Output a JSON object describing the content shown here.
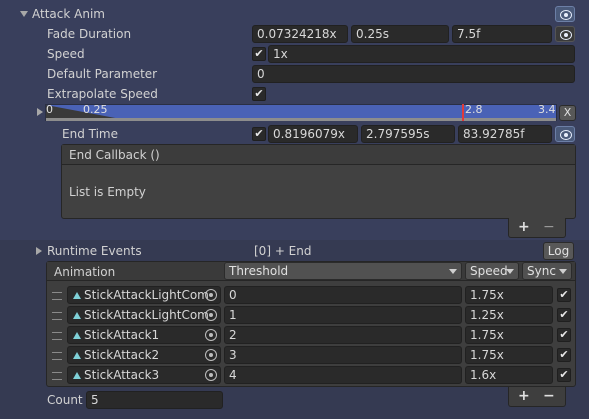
{
  "header": {
    "title": "Attack Anim"
  },
  "fade_duration": {
    "label": "Fade Duration",
    "values": [
      "0.07324218x",
      "0.25s",
      "7.5f"
    ]
  },
  "speed": {
    "label": "Speed",
    "checked": true,
    "value": "1x"
  },
  "default_parameter": {
    "label": "Default Parameter",
    "value": "0"
  },
  "extrapolate_speed": {
    "label": "Extrapolate Speed",
    "checked": true
  },
  "timeline": {
    "start_label": "0",
    "tick_label": "0.25",
    "end_time_label": "2.8",
    "length_label": "3.4",
    "close_label": "X"
  },
  "end_time": {
    "label": "End Time",
    "checked": true,
    "values": [
      "0.8196079x",
      "2.797595s",
      "83.92785f"
    ]
  },
  "end_callback": {
    "header": "End Callback ()",
    "empty_text": "List is Empty",
    "add_label": "+",
    "remove_label": "−"
  },
  "runtime_events": {
    "label": "Runtime Events",
    "summary": "[0] + End",
    "log_button": "Log"
  },
  "animation_table": {
    "column_animation": "Animation",
    "column_threshold": "Threshold",
    "column_speed": "Speed",
    "column_sync": "Sync",
    "rows": [
      {
        "clip": "StickAttackLightCom",
        "threshold": "0",
        "speed": "1.75x",
        "sync": true
      },
      {
        "clip": "StickAttackLightCom",
        "threshold": "1",
        "speed": "1.25x",
        "sync": true
      },
      {
        "clip": "StickAttack1",
        "threshold": "2",
        "speed": "1.75x",
        "sync": true
      },
      {
        "clip": "StickAttack2",
        "threshold": "3",
        "speed": "1.75x",
        "sync": true
      },
      {
        "clip": "StickAttack3",
        "threshold": "4",
        "speed": "1.6x",
        "sync": true
      }
    ],
    "count_label": "Count",
    "count_value": "5",
    "add_label": "+",
    "remove_label": "−"
  },
  "colors": {
    "panel_blue": "#393f5c",
    "timeline_fill": "#4a62b6",
    "end_marker": "#e03a3a",
    "clip_icon": "#7fd1d8"
  },
  "icons": [
    "foldout-down-icon",
    "foldout-right-icon",
    "eye-icon",
    "check-icon",
    "animation-clip-icon",
    "object-picker-icon",
    "drag-handle-icon"
  ]
}
